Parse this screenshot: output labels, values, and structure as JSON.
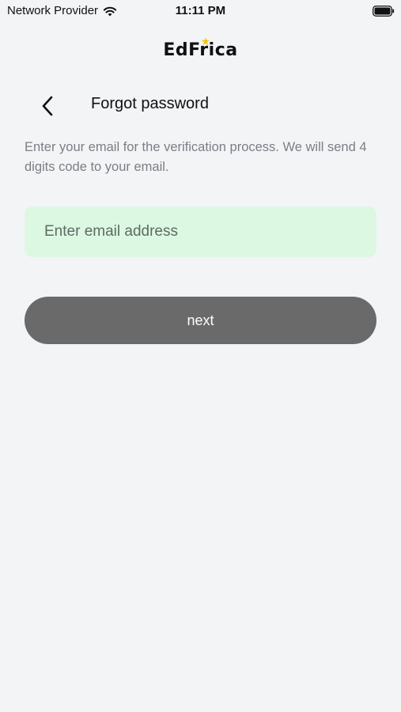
{
  "status_bar": {
    "carrier": "Network Provider",
    "time": "11:11 PM",
    "wifi_icon": "wifi-icon",
    "battery_icon": "battery-icon"
  },
  "app": {
    "logo_text": "EdFrica",
    "logo_star_color": "#f5c400"
  },
  "header": {
    "back_icon": "chevron-left-icon",
    "title": "Forgot password"
  },
  "form": {
    "instructions": "Enter your email for the verification process. We will send 4 digits code to your email.",
    "email": {
      "value": "",
      "placeholder": "Enter email address",
      "background_color": "#dcf8e3"
    },
    "next_button": {
      "label": "next",
      "background_color": "#6a6a6a"
    }
  }
}
